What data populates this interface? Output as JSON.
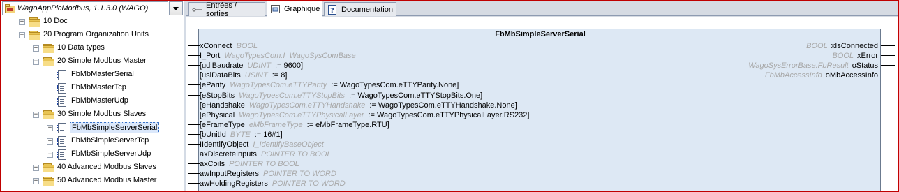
{
  "library_header": "WagoAppPlcModbus, 1.1.3.0 (WAGO)",
  "tree": [
    {
      "label": "10 Doc",
      "kind": "folder",
      "expander": "+"
    },
    {
      "label": "20 Program Organization Units",
      "kind": "folder",
      "expander": "-"
    },
    {
      "label": "10 Data types",
      "kind": "folder",
      "expander": "+"
    },
    {
      "label": "20 Simple Modbus Master",
      "kind": "folder",
      "expander": "-"
    },
    {
      "label": "FbMbMasterSerial",
      "kind": "doc",
      "expander": ""
    },
    {
      "label": "FbMbMasterTcp",
      "kind": "doc",
      "expander": ""
    },
    {
      "label": "FbMbMasterUdp",
      "kind": "doc",
      "expander": ""
    },
    {
      "label": "30 Simple Modbus Slaves",
      "kind": "folder",
      "expander": "-"
    },
    {
      "label": "FbMbSimpleServerSerial",
      "kind": "doc",
      "expander": "+"
    },
    {
      "label": "FbMbSimpleServerTcp",
      "kind": "doc",
      "expander": "+"
    },
    {
      "label": "FbMbSimpleServerUdp",
      "kind": "doc",
      "expander": "+"
    },
    {
      "label": "40 Advanced Modbus Slaves",
      "kind": "folder",
      "expander": "+"
    },
    {
      "label": "50 Advanced Modbus Master",
      "kind": "folder",
      "expander": "+"
    }
  ],
  "tabs": [
    {
      "label": "Entrées / sorties",
      "icon": "io-icon"
    },
    {
      "label": "Graphique",
      "icon": "graph-icon"
    },
    {
      "label": "Documentation",
      "icon": "help-icon"
    }
  ],
  "active_tab": "Graphique",
  "fb": {
    "title": "FbMbSimpleServerSerial",
    "inputs": [
      {
        "name": "xConnect",
        "type": "BOOL",
        "init": ""
      },
      {
        "name": "I_Port",
        "type": "WagoTypesCom.I_WagoSysComBase",
        "init": ""
      },
      {
        "name": "[udiBaudrate",
        "type": "UDINT",
        "init": ":= 9600]"
      },
      {
        "name": "[usiDataBits",
        "type": "USINT",
        "init": ":= 8]"
      },
      {
        "name": "[eParity",
        "type": "WagoTypesCom.eTTYParity",
        "init": ":= WagoTypesCom.eTTYParity.None]"
      },
      {
        "name": "[eStopBits",
        "type": "WagoTypesCom.eTTYStopBits",
        "init": ":= WagoTypesCom.eTTYStopBits.One]"
      },
      {
        "name": "[eHandshake",
        "type": "WagoTypesCom.eTTYHandshake",
        "init": ":= WagoTypesCom.eTTYHandshake.None]"
      },
      {
        "name": "[ePhysical",
        "type": "WagoTypesCom.eTTYPhysicalLayer",
        "init": ":= WagoTypesCom.eTTYPhysicalLayer.RS232]"
      },
      {
        "name": "[eFrameType",
        "type": "eMbFrameType",
        "init": ":= eMbFrameType.RTU]"
      },
      {
        "name": "[bUnitId",
        "type": "BYTE",
        "init": ":= 16#1]"
      },
      {
        "name": "IIdentifyObject",
        "type": "I_IdentifyBaseObject",
        "init": ""
      },
      {
        "name": "axDiscreteInputs",
        "type": "POINTER TO BOOL",
        "init": ""
      },
      {
        "name": "axCoils",
        "type": "POINTER TO BOOL",
        "init": ""
      },
      {
        "name": "awInputRegisters",
        "type": "POINTER TO WORD",
        "init": ""
      },
      {
        "name": "awHoldingRegisters",
        "type": "POINTER TO WORD",
        "init": ""
      }
    ],
    "outputs": [
      {
        "name": "xIsConnected",
        "type": "BOOL"
      },
      {
        "name": "xError",
        "type": "BOOL"
      },
      {
        "name": "oStatus",
        "type": "WagoSysErrorBase.FbResult"
      },
      {
        "name": "oMbAccessInfo",
        "type": "FbMbAccessInfo"
      }
    ]
  }
}
